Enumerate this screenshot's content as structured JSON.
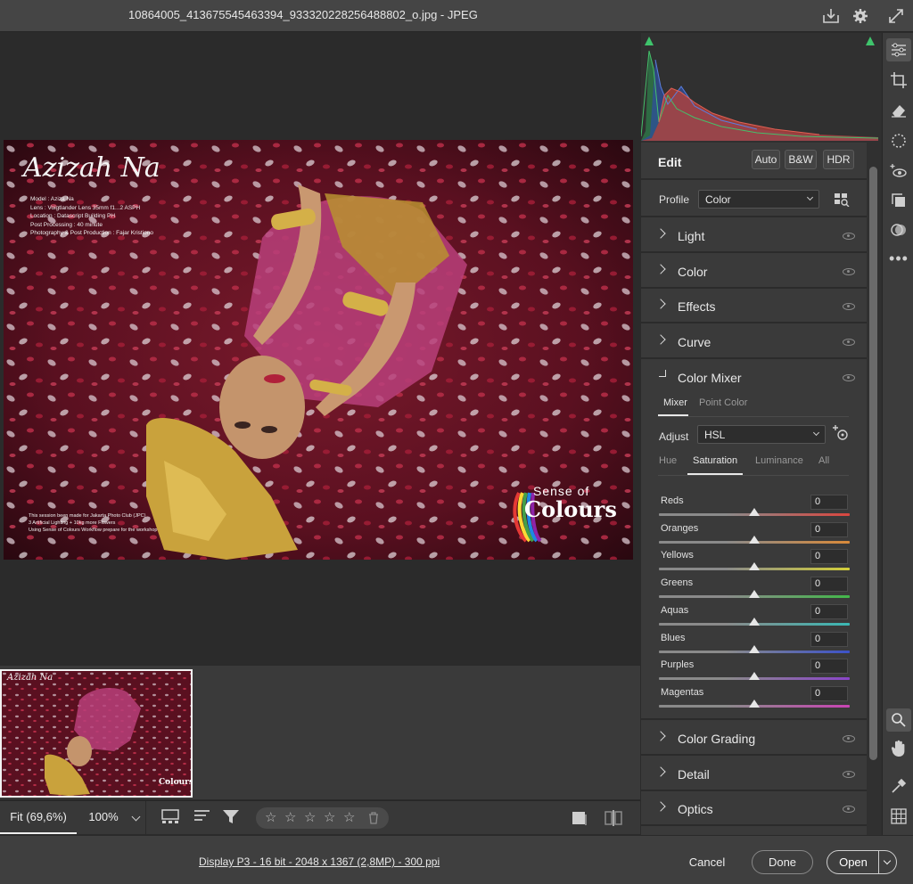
{
  "window": {
    "title": "10864005_413675545463394_933320228256488802_o.jpg  -  JPEG"
  },
  "photo": {
    "script_title": "Azizah Na",
    "credits": [
      "Model : Aziza Na",
      "Lens : Voigtlander Lens 35mm f1...2 ASPH",
      "Location : Datascript Building PH",
      "Post Processing : 40 minute",
      "Photography & Post Production : Fajar Kristiono"
    ],
    "footnote": [
      "This session been made for Jakarta Photo Club (JPC)",
      "3 Artificial Lighting + 10kg more Flowers",
      "Using Sense of Colours Workflow prepare for the workshop"
    ],
    "logo_top": "Sense of",
    "logo_main": "Colours"
  },
  "thumbnail": {
    "script_title": "Azizah Na",
    "logo_main": "Colours"
  },
  "bottombar": {
    "zoom_fit": "Fit (69,6%)",
    "zoom_pct": "100%"
  },
  "status": {
    "file_info": "Display P3 - 16 bit - 2048 x 1367 (2,8MP) - 300 ppi"
  },
  "footer": {
    "cancel": "Cancel",
    "done": "Done",
    "open": "Open"
  },
  "edit": {
    "title": "Edit",
    "auto": "Auto",
    "bw": "B&W",
    "hdr": "HDR",
    "profile_label": "Profile",
    "profile_value": "Color"
  },
  "sections": {
    "light": "Light",
    "color": "Color",
    "effects": "Effects",
    "curve": "Curve",
    "color_mixer": "Color Mixer",
    "color_grading": "Color Grading",
    "detail": "Detail",
    "optics": "Optics"
  },
  "mixer": {
    "tabs": {
      "mixer": "Mixer",
      "point_color": "Point Color"
    },
    "adjust_label": "Adjust",
    "adjust_value": "HSL",
    "subtabs": {
      "hue": "Hue",
      "saturation": "Saturation",
      "luminance": "Luminance",
      "all": "All"
    },
    "sliders": [
      {
        "label": "Reds",
        "value": "0",
        "color": "#d9463f"
      },
      {
        "label": "Oranges",
        "value": "0",
        "color": "#d98a3a"
      },
      {
        "label": "Yellows",
        "value": "0",
        "color": "#d3cf3a"
      },
      {
        "label": "Greens",
        "value": "0",
        "color": "#43b84a"
      },
      {
        "label": "Aquas",
        "value": "0",
        "color": "#3ab8b4"
      },
      {
        "label": "Blues",
        "value": "0",
        "color": "#3c52c9"
      },
      {
        "label": "Purples",
        "value": "0",
        "color": "#8a45c9"
      },
      {
        "label": "Magentas",
        "value": "0",
        "color": "#c944b4"
      }
    ]
  },
  "colors": {
    "accent": "#2c8cf0",
    "histogram_green": "#3fc46c"
  }
}
